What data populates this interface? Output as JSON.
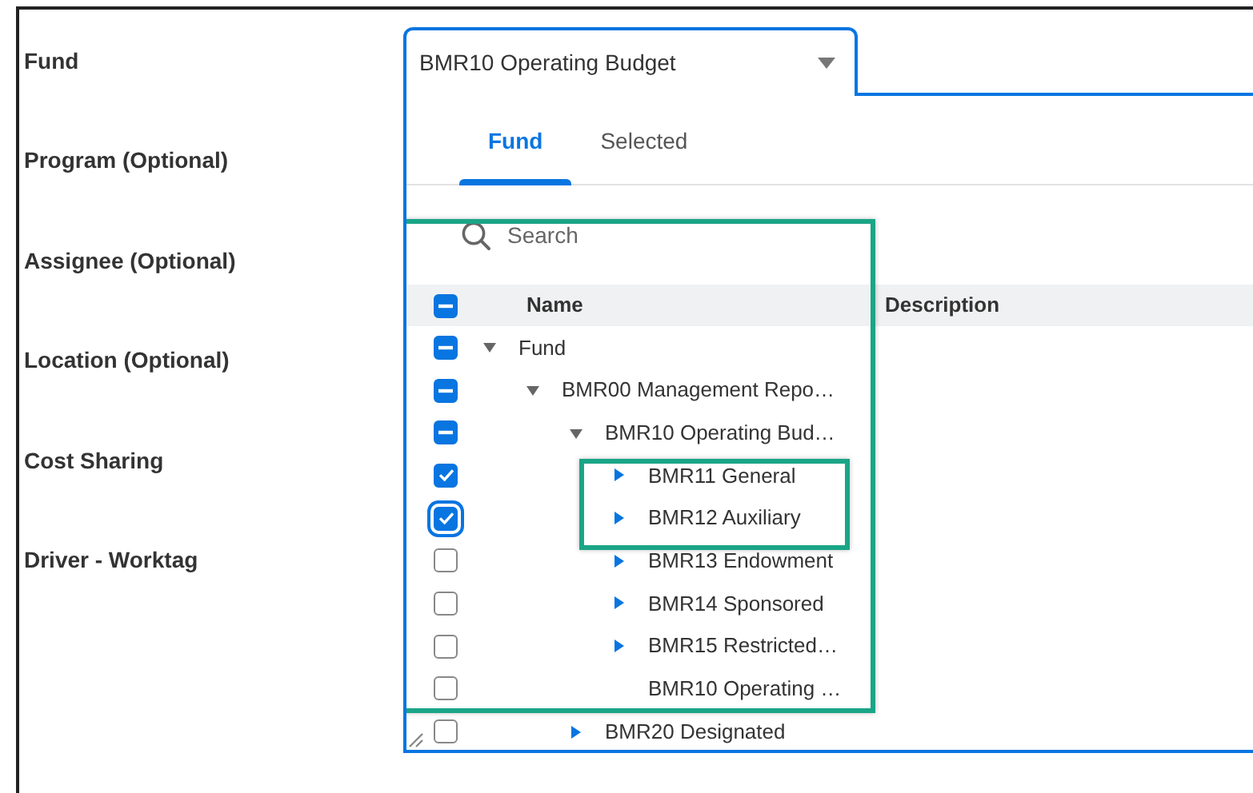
{
  "form_labels": [
    "Fund",
    "Program (Optional)",
    "Assignee (Optional)",
    "Location (Optional)",
    "Cost Sharing",
    "Driver - Worktag"
  ],
  "fund_field": {
    "value": "BMR10 Operating Budget",
    "expanded": true
  },
  "tabs": [
    {
      "label": "Fund",
      "selected": true
    },
    {
      "label": "Selected",
      "selected": false
    }
  ],
  "search": {
    "placeholder": "Search"
  },
  "table": {
    "columns": [
      "Name",
      "Description"
    ],
    "header_checkbox": {
      "checked": true,
      "indeterminate": true
    },
    "rows": [
      {
        "name": "Fund",
        "checked": true,
        "indeterminate": true,
        "expanded": true,
        "children": [
          {
            "name": "BMR00 Management Repo…",
            "checked": true,
            "indeterminate": true,
            "expanded": true,
            "children": [
              {
                "name": "BMR10 Operating Bud…",
                "checked": true,
                "indeterminate": true,
                "expanded": true,
                "children": [
                  {
                    "name": "BMR11 General",
                    "checked": true,
                    "indeterminate": false,
                    "expanded": false
                  },
                  {
                    "name": "BMR12 Auxiliary",
                    "checked": true,
                    "indeterminate": false,
                    "focused": true,
                    "expanded": false
                  },
                  {
                    "name": "BMR13 Endowment",
                    "checked": false,
                    "indeterminate": false,
                    "expanded": false
                  },
                  {
                    "name": "BMR14 Sponsored",
                    "checked": false,
                    "indeterminate": false,
                    "expanded": false
                  },
                  {
                    "name": "BMR15 Restricted…",
                    "checked": false,
                    "indeterminate": false,
                    "expanded": false
                  },
                  {
                    "name": "BMR10 Operating …",
                    "checked": false,
                    "indeterminate": false
                  }
                ]
              },
              {
                "name": "BMR20 Designated",
                "checked": false,
                "indeterminate": false,
                "expanded": false
              }
            ]
          }
        ]
      }
    ]
  }
}
